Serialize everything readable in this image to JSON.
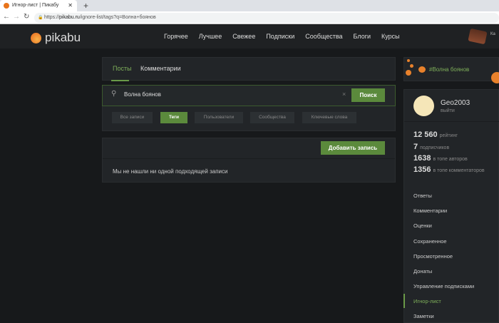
{
  "browser": {
    "tab_title": "Игнор-лист | Пикабу",
    "url_prefix": "https://",
    "url_domain": "pikabu.ru",
    "url_path": "/ignore-list/tags?q=Волна+боянов"
  },
  "header": {
    "logo": "pikabu",
    "menu": [
      "Горячее",
      "Лучшее",
      "Свежее",
      "Подписки",
      "Сообщества",
      "Блоги",
      "Курсы"
    ],
    "promo_text": "Ка"
  },
  "tabs": [
    "Посты",
    "Комментарии"
  ],
  "search": {
    "value": "Волна боянов",
    "button": "Поиск",
    "filters": [
      "Все записи",
      "Теги",
      "Пользователи",
      "Сообщества",
      "Ключевые слова"
    ],
    "active_filter": "Теги"
  },
  "results": {
    "add_button": "Добавить запись",
    "empty_text": "Мы не нашли ни одной подходящей записи"
  },
  "sidebar": {
    "banner": "#Волна боянов",
    "user": {
      "name": "Geo2003",
      "logout": "выйти"
    },
    "stats": [
      {
        "value": "12 560",
        "label": "рейтинг"
      },
      {
        "value": "7",
        "label": "подписчиков"
      },
      {
        "value": "1638",
        "label": "в топе авторов"
      },
      {
        "value": "1356",
        "label": "в топе комментаторов"
      }
    ],
    "menu": [
      "Ответы",
      "Комментарии",
      "Оценки",
      "Сохраненное",
      "Просмотренное",
      "Донаты",
      "Управление подписками",
      "Игнор-лист",
      "Заметки"
    ],
    "active_menu": "Игнор-лист"
  },
  "colors": {
    "accent": "#5b8a3c",
    "accent_text": "#7fb05a",
    "background": "#17191b",
    "card": "#222528"
  }
}
